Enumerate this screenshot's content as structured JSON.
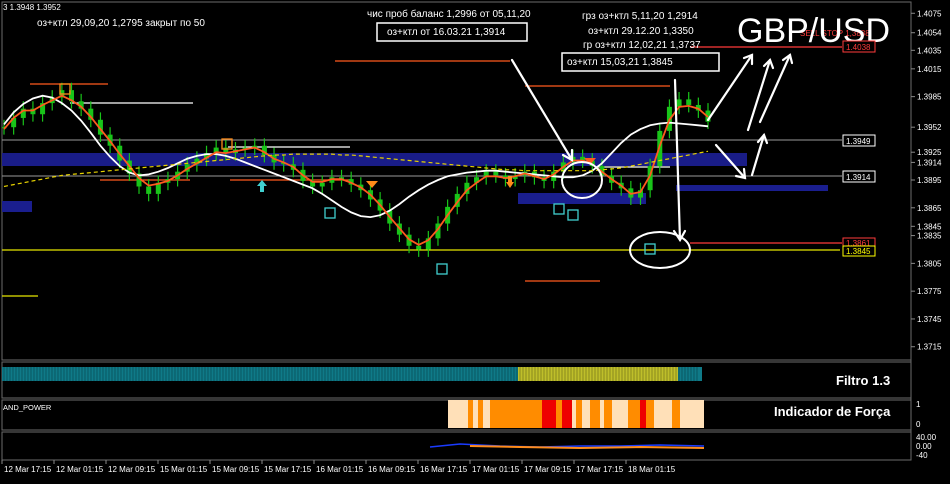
{
  "window": {
    "title": "3 1.3948 1.3952"
  },
  "symbol": "GBP/USD",
  "chart_data": {
    "type": "line",
    "title": "GBP/USD",
    "x_tick_labels": [
      "12 Mar 17:15",
      "12 Mar 01:15",
      "12 Mar 09:15",
      "15 Mar 01:15",
      "15 Mar 09:15",
      "15 Mar 17:15",
      "16 Mar 01:15",
      "16 Mar 09:15",
      "16 Mar 17:15",
      "17 Mar 01:15",
      "17 Mar 09:15",
      "17 Mar 17:15",
      "18 Mar 01:15"
    ],
    "y_tick_labels": [
      "1.4075",
      "1.4054",
      "1.4035",
      "1.4015",
      "1.3985",
      "1.3952",
      "1.3925",
      "1.3914",
      "1.3895",
      "1.3865",
      "1.3845",
      "1.3835",
      "1.3805",
      "1.3775",
      "1.3745",
      "1.3715"
    ],
    "ylim": [
      1.3705,
      1.4085
    ],
    "price_series": {
      "name": "",
      "values": [
        1.3952,
        1.3962,
        1.3972,
        1.3966,
        1.3978,
        1.3984,
        1.3992,
        1.398,
        1.3972,
        1.396,
        1.3944,
        1.3932,
        1.3916,
        1.3902,
        1.3888,
        1.388,
        1.3892,
        1.3896,
        1.3904,
        1.3912,
        1.3918,
        1.3924,
        1.393,
        1.3924,
        1.3928,
        1.393,
        1.3932,
        1.3922,
        1.3914,
        1.3912,
        1.3906,
        1.3894,
        1.3888,
        1.3892,
        1.3898,
        1.3896,
        1.389,
        1.3884,
        1.3874,
        1.3862,
        1.3848,
        1.3836,
        1.3824,
        1.382,
        1.3832,
        1.3848,
        1.3866,
        1.388,
        1.3892,
        1.3898,
        1.3904,
        1.39,
        1.3896,
        1.39,
        1.3904,
        1.3898,
        1.3894,
        1.3904,
        1.3914,
        1.392,
        1.3916,
        1.391,
        1.39,
        1.3892,
        1.3886,
        1.3876,
        1.3884,
        1.391,
        1.3948,
        1.3974,
        1.3982,
        1.3976,
        1.397,
        1.3958
      ]
    },
    "moving_averages": [
      {
        "name": "",
        "color": "#ffffff",
        "values": [
          1.3955,
          1.3968,
          1.3977,
          1.3983,
          1.3986,
          1.3984,
          1.3978,
          1.397,
          1.3959,
          1.3946,
          1.3932,
          1.392,
          1.391,
          1.3903,
          1.39,
          1.3901,
          1.3904,
          1.3908,
          1.3913,
          1.3918,
          1.3921,
          1.3923,
          1.3923,
          1.3921,
          1.3918,
          1.3914,
          1.391,
          1.3906,
          1.3902,
          1.3898,
          1.3894,
          1.389,
          1.3886,
          1.388,
          1.3873,
          1.3866,
          1.386,
          1.3856,
          1.3855,
          1.3857,
          1.3862,
          1.3869,
          1.3877,
          1.3884,
          1.389,
          1.3895,
          1.3899,
          1.3901,
          1.3903,
          1.3904,
          1.3905,
          1.3905,
          1.3904,
          1.3903,
          1.3902,
          1.3901,
          1.39,
          1.3899,
          1.3898,
          1.3898,
          1.39,
          1.3905,
          1.3913,
          1.3924,
          1.3935,
          1.3944,
          1.395,
          1.3954,
          1.3956,
          1.3957,
          1.3956,
          1.3955,
          1.3954,
          1.3953
        ]
      },
      {
        "name": "",
        "color": "#ff5a1e",
        "values": [
          1.395,
          1.3962,
          1.397,
          1.397,
          1.3976,
          1.3981,
          1.3986,
          1.3981,
          1.3974,
          1.3963,
          1.395,
          1.3937,
          1.3923,
          1.391,
          1.3897,
          1.3889,
          1.3891,
          1.3894,
          1.39,
          1.3907,
          1.3913,
          1.3919,
          1.3925,
          1.3924,
          1.3926,
          1.3928,
          1.393,
          1.3925,
          1.3918,
          1.3914,
          1.3909,
          1.39,
          1.3893,
          1.3893,
          1.3896,
          1.3896,
          1.3892,
          1.3887,
          1.3879,
          1.3868,
          1.3855,
          1.3843,
          1.3831,
          1.3825,
          1.383,
          1.3842,
          1.3857,
          1.3871,
          1.3884,
          1.3892,
          1.3899,
          1.3899,
          1.3897,
          1.3899,
          1.3902,
          1.3899,
          1.3896,
          1.3901,
          1.3909,
          1.3916,
          1.3916,
          1.3912,
          1.3904,
          1.3896,
          1.3889,
          1.388,
          1.3882,
          1.39,
          1.3932,
          1.396,
          1.3974,
          1.3975,
          1.3972,
          1.3963
        ]
      },
      {
        "name": "",
        "color": "#e6d200",
        "values": [
          1.3888,
          1.389,
          1.3892,
          1.3894,
          1.3896,
          1.3898,
          1.39,
          1.3901,
          1.3902,
          1.3903,
          1.3904,
          1.3905,
          1.3906,
          1.3907,
          1.3908,
          1.3909,
          1.391,
          1.3911,
          1.3912,
          1.3913,
          1.3914,
          1.3915,
          1.3916,
          1.3917,
          1.3918,
          1.3919,
          1.392,
          1.3921,
          1.3922,
          1.3922,
          1.3923,
          1.3923,
          1.3923,
          1.3923,
          1.3923,
          1.3922,
          1.3922,
          1.3921,
          1.392,
          1.3919,
          1.3918,
          1.3917,
          1.3916,
          1.3915,
          1.3914,
          1.3913,
          1.3912,
          1.3911,
          1.391,
          1.3909,
          1.3908,
          1.3907,
          1.3906,
          1.3906,
          1.3905,
          1.3905,
          1.3905,
          1.3905,
          1.3905,
          1.3905,
          1.3905,
          1.3905,
          1.3906,
          1.3907,
          1.3908,
          1.391,
          1.3912,
          1.3914,
          1.3916,
          1.3918,
          1.392,
          1.3922,
          1.3924,
          1.3926
        ]
      }
    ],
    "price_labels": [
      {
        "text": "1.4038",
        "color": "#ff3b3b"
      },
      {
        "text": "1.3949",
        "color": "#ffffff"
      },
      {
        "text": "1.3914",
        "color": "#ffffff"
      },
      {
        "text": "1.3861",
        "color": "#ff3b3b"
      },
      {
        "text": "1.3845",
        "color": "#ffff00"
      }
    ],
    "annotations": [
      "оз+ктл 29,09,20 1,2795 закрыт по 50",
      "чис проб баланс 1,2996 от 05,11,20",
      "оз+ктл от 16.03.21  1,3914",
      "грз оз+ктл 5,11,20  1,2914",
      "оз+ктл 29.12.20  1,3350",
      "гр оз+ктл 12,02,21 1,3737",
      "оз+ктл 15,03,21 1,3845",
      "SELL STOP  1,3888"
    ],
    "indicator_panels": [
      {
        "name": "ENT_FILTER_1.3",
        "title": "Filtro 1.3"
      },
      {
        "name": "AND_POWER",
        "title": "Indicador de Força",
        "axis": [
          "1",
          "0"
        ]
      },
      {
        "name": "",
        "axis": [
          "40.00",
          "0.00",
          "-40"
        ]
      }
    ],
    "grid": false
  }
}
